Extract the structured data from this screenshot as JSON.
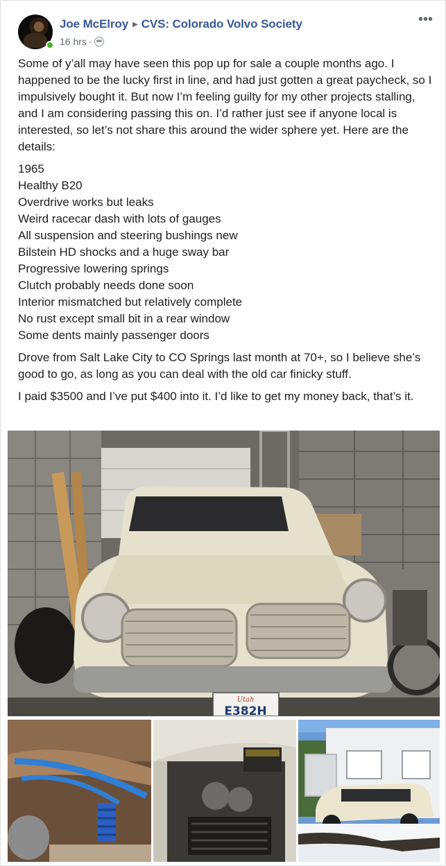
{
  "post": {
    "author": "Joe McElroy",
    "group": "CVS: Colorado Volvo Society",
    "timestamp": "16 hrs",
    "privacy_icon": "group-icon",
    "more_icon": "more-options-icon",
    "paragraphs": [
      "Some of y’all may have seen this pop up for sale a couple months ago. I happened to be the lucky first in line, and had just gotten a great paycheck, so I impulsively bought it. But now I’m feeling guilty for my other projects stalling, and I am considering passing this on. I’d rather just see if anyone local is interested, so let’s not share this around the wider sphere yet. Here are the details:"
    ],
    "specs": [
      "1965",
      "Healthy B20",
      "Overdrive works but leaks",
      "Weird racecar dash with lots of gauges",
      "All suspension and steering bushings new",
      "Bilstein HD shocks and a huge sway bar",
      "Progressive lowering springs",
      "Clutch probably needs done soon",
      "Interior mismatched but relatively complete",
      "No rust except small bit in a rear window",
      "Some dents mainly passenger doors"
    ],
    "closing": [
      "Drove from Salt Lake City to CO Springs last month at 70+, so I believe she’s good to go, as long as you can deal with the old car finicky stuff.",
      "I paid $3500 and I’ve put $400 into it. I’d like to get my money back, that’s it."
    ],
    "photos": {
      "plate_state": "Utah",
      "plate_number": "E382H"
    }
  },
  "colors": {
    "link": "#385898",
    "meta": "#606770",
    "online": "#42b72a"
  }
}
